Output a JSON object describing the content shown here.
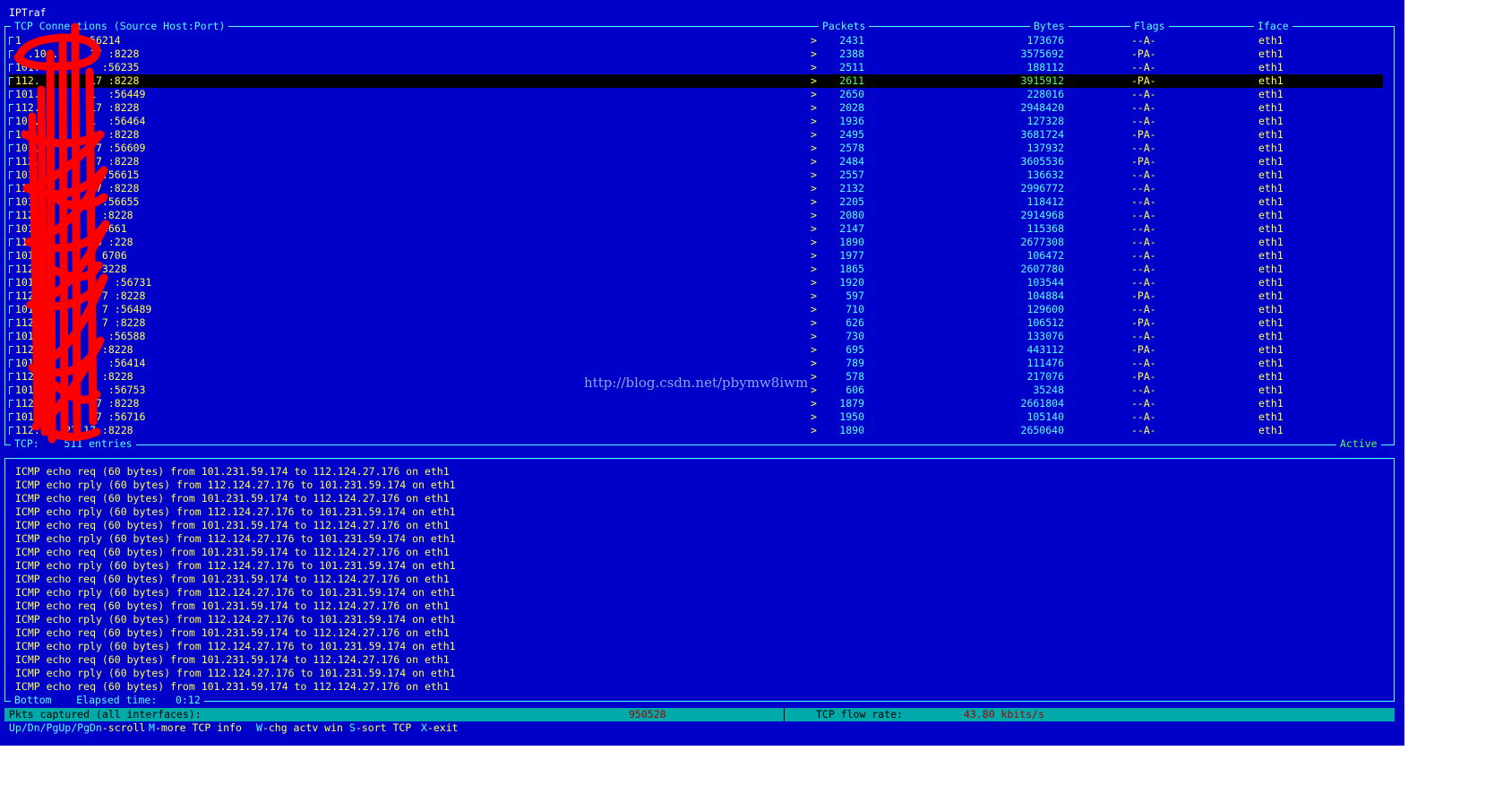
{
  "app": {
    "title": "IPTraf"
  },
  "tcp_panel": {
    "headers": {
      "connections": "TCP Connections (Source Host:Port)",
      "packets": "Packets",
      "bytes": "Bytes",
      "flags": "Flags",
      "iface": "Iface"
    },
    "rows": [
      {
        "src": "1          :56214",
        "dir": ">",
        "packets": "2431",
        "bytes": "173676",
        "flags": "--A-",
        "iface": "eth1"
      },
      {
        "src": "  .104.     17 :8228",
        "dir": ">",
        "packets": "2388",
        "bytes": "3575692",
        "flags": "-PA-",
        "iface": "eth1"
      },
      {
        "src": "101.          :56235",
        "dir": ">",
        "packets": "2511",
        "bytes": "188112",
        "flags": "--A-",
        "iface": "eth1"
      },
      {
        "src": "112.        17 :8228",
        "dir": ">",
        "packets": "2611",
        "bytes": "3915912",
        "flags": "-PA-",
        "iface": "eth1"
      },
      {
        "src": "101.        1  :56449",
        "dir": ">",
        "packets": "2650",
        "bytes": "228016",
        "flags": "--A-",
        "iface": "eth1"
      },
      {
        "src": "112.        17 :8228",
        "dir": ">",
        "packets": "2028",
        "bytes": "2948420",
        "flags": "--A-",
        "iface": "eth1"
      },
      {
        "src": "101.        1  :56464",
        "dir": ">",
        "packets": "1936",
        "bytes": "127328",
        "flags": "--A-",
        "iface": "eth1"
      },
      {
        "src": "112.        1  :8228",
        "dir": ">",
        "packets": "2495",
        "bytes": "3681724",
        "flags": "-PA-",
        "iface": "eth1"
      },
      {
        "src": "101.         7 :56609",
        "dir": ">",
        "packets": "2578",
        "bytes": "137932",
        "flags": "--A-",
        "iface": "eth1"
      },
      {
        "src": "112.         7 :8228",
        "dir": ">",
        "packets": "2484",
        "bytes": "3605536",
        "flags": "-PA-",
        "iface": "eth1"
      },
      {
        "src": "101.          :56615",
        "dir": ">",
        "packets": "2557",
        "bytes": "136632",
        "flags": "--A-",
        "iface": "eth1"
      },
      {
        "src": "112.         7 :8228",
        "dir": ">",
        "packets": "2132",
        "bytes": "2996772",
        "flags": "--A-",
        "iface": "eth1"
      },
      {
        "src": "101.          :56655",
        "dir": ">",
        "packets": "2205",
        "bytes": "118412",
        "flags": "--A-",
        "iface": "eth1"
      },
      {
        "src": "112.          :8228",
        "dir": ">",
        "packets": "2080",
        "bytes": "2914968",
        "flags": "--A-",
        "iface": "eth1"
      },
      {
        "src": "101.          6661",
        "dir": ">",
        "packets": "2147",
        "bytes": "115368",
        "flags": "--A-",
        "iface": "eth1"
      },
      {
        "src": "112.         5 :228",
        "dir": ">",
        "packets": "1890",
        "bytes": "2677308",
        "flags": "--A-",
        "iface": "eth1"
      },
      {
        "src": "101.          6706",
        "dir": ">",
        "packets": "1977",
        "bytes": "106472",
        "flags": "--A-",
        "iface": "eth1"
      },
      {
        "src": "112.          3228",
        "dir": ">",
        "packets": "1865",
        "bytes": "2607780",
        "flags": "--A-",
        "iface": "eth1"
      },
      {
        "src": "101.          7 :56731",
        "dir": ">",
        "packets": "1920",
        "bytes": "103544",
        "flags": "--A-",
        "iface": "eth1"
      },
      {
        "src": "112.          7 :8228",
        "dir": ">",
        "packets": "597",
        "bytes": "104884",
        "flags": "-PA-",
        "iface": "eth1"
      },
      {
        "src": "101.          7 :56489",
        "dir": ">",
        "packets": "710",
        "bytes": "129600",
        "flags": "--A-",
        "iface": "eth1"
      },
      {
        "src": "112.          7 :8228",
        "dir": ">",
        "packets": "626",
        "bytes": "106512",
        "flags": "-PA-",
        "iface": "eth1"
      },
      {
        "src": "101.           :56588",
        "dir": ">",
        "packets": "730",
        "bytes": "133076",
        "flags": "--A-",
        "iface": "eth1"
      },
      {
        "src": "112.          :8228",
        "dir": ">",
        "packets": "695",
        "bytes": "443112",
        "flags": "-PA-",
        "iface": "eth1"
      },
      {
        "src": "101.        1  :56414",
        "dir": ">",
        "packets": "789",
        "bytes": "111476",
        "flags": "--A-",
        "iface": "eth1"
      },
      {
        "src": "112.          :8228",
        "dir": ">",
        "packets": "578",
        "bytes": "217076",
        "flags": "-PA-",
        "iface": "eth1"
      },
      {
        "src": "101.        1  :56753",
        "dir": ">",
        "packets": "606",
        "bytes": "35248",
        "flags": "--A-",
        "iface": "eth1"
      },
      {
        "src": "112.         7 :8228",
        "dir": ">",
        "packets": "1879",
        "bytes": "2661804",
        "flags": "--A-",
        "iface": "eth1"
      },
      {
        "src": "101.         7 :56716",
        "dir": ">",
        "packets": "1950",
        "bytes": "105140",
        "flags": "--A-",
        "iface": "eth1"
      },
      {
        "src": "112.    27.17 :8228",
        "dir": ">",
        "packets": "1890",
        "bytes": "2650640",
        "flags": "--A-",
        "iface": "eth1"
      }
    ],
    "selected_row": 3,
    "footer_label": "TCP:",
    "entries": "511 entries",
    "state": "Active"
  },
  "icmp_log": {
    "lines": [
      "ICMP echo req (60 bytes) from 101.231.59.174 to 112.124.27.176 on eth1",
      "ICMP echo rply (60 bytes) from 112.124.27.176 to 101.231.59.174 on eth1",
      "ICMP echo req (60 bytes) from 101.231.59.174 to 112.124.27.176 on eth1",
      "ICMP echo rply (60 bytes) from 112.124.27.176 to 101.231.59.174 on eth1",
      "ICMP echo req (60 bytes) from 101.231.59.174 to 112.124.27.176 on eth1",
      "ICMP echo rply (60 bytes) from 112.124.27.176 to 101.231.59.174 on eth1",
      "ICMP echo req (60 bytes) from 101.231.59.174 to 112.124.27.176 on eth1",
      "ICMP echo rply (60 bytes) from 112.124.27.176 to 101.231.59.174 on eth1",
      "ICMP echo req (60 bytes) from 101.231.59.174 to 112.124.27.176 on eth1",
      "ICMP echo rply (60 bytes) from 112.124.27.176 to 101.231.59.174 on eth1",
      "ICMP echo req (60 bytes) from 101.231.59.174 to 112.124.27.176 on eth1",
      "ICMP echo rply (60 bytes) from 112.124.27.176 to 101.231.59.174 on eth1",
      "ICMP echo req (60 bytes) from 101.231.59.174 to 112.124.27.176 on eth1",
      "ICMP echo rply (60 bytes) from 112.124.27.176 to 101.231.59.174 on eth1",
      "ICMP echo req (60 bytes) from 101.231.59.174 to 112.124.27.176 on eth1",
      "ICMP echo rply (60 bytes) from 112.124.27.176 to 101.231.59.174 on eth1",
      "ICMP echo req (60 bytes) from 101.231.59.174 to 112.124.27.176 on eth1"
    ],
    "footer_position": "Bottom",
    "elapsed_label": "Elapsed time:",
    "elapsed_value": "0:12"
  },
  "status": {
    "pkts_label": "Pkts captured (all interfaces):",
    "pkts_value": "950528",
    "rate_label": "TCP flow rate:",
    "rate_value": "43.80 kbits/s"
  },
  "help": {
    "scroll_key": "Up/Dn/PgUp/PgDn",
    "scroll_text": "-scroll",
    "more_key": "M",
    "more_text": "-more TCP info",
    "win_key": "W",
    "win_text": "-chg actv win",
    "sort_key": "S",
    "sort_text": "-sort TCP",
    "exit_key": "X",
    "exit_text": "-exit"
  },
  "watermark": "http://blog.csdn.net/pbymw8iwm",
  "colors": {
    "background": "#0000c8",
    "text_primary": "#ffff55",
    "text_numeric": "#55ffff",
    "selected_numeric": "#55ff55",
    "status_bar": "#00aaaa",
    "status_value": "#aa0000",
    "redaction": "#ff0000"
  }
}
